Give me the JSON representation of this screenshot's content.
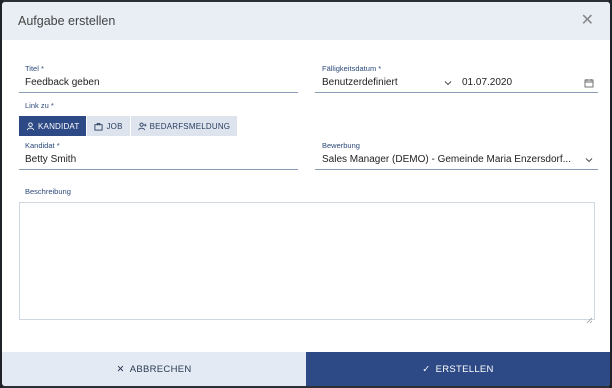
{
  "dialog": {
    "title": "Aufgabe erstellen",
    "close_icon": "close-icon"
  },
  "form": {
    "title": {
      "label": "Titel *",
      "value": "Feedback geben"
    },
    "due_date": {
      "label": "Fälligkeitsdatum *",
      "mode_value": "Benutzerdefiniert",
      "date_value": "01.07.2020",
      "calendar_icon": "calendar-icon"
    },
    "link_to": {
      "label": "Link zu *",
      "options": [
        {
          "label": "KANDIDAT",
          "icon": "person-icon",
          "active": true
        },
        {
          "label": "JOB",
          "icon": "briefcase-icon",
          "active": false
        },
        {
          "label": "BEDARFSMELDUNG",
          "icon": "person-add-icon",
          "active": false
        }
      ]
    },
    "candidate": {
      "label": "Kandidat *",
      "value": "Betty Smith"
    },
    "application": {
      "label": "Bewerbung",
      "value": "Sales Manager (DEMO) - Gemeinde Maria Enzersdorf..."
    },
    "description": {
      "label": "Beschreibung",
      "value": ""
    }
  },
  "footer": {
    "cancel_label": "ABBRECHEN",
    "create_label": "ERSTELLEN"
  },
  "colors": {
    "primary": "#2d4a86",
    "header_bg": "#e9eef5",
    "label": "#2c4a7a"
  }
}
